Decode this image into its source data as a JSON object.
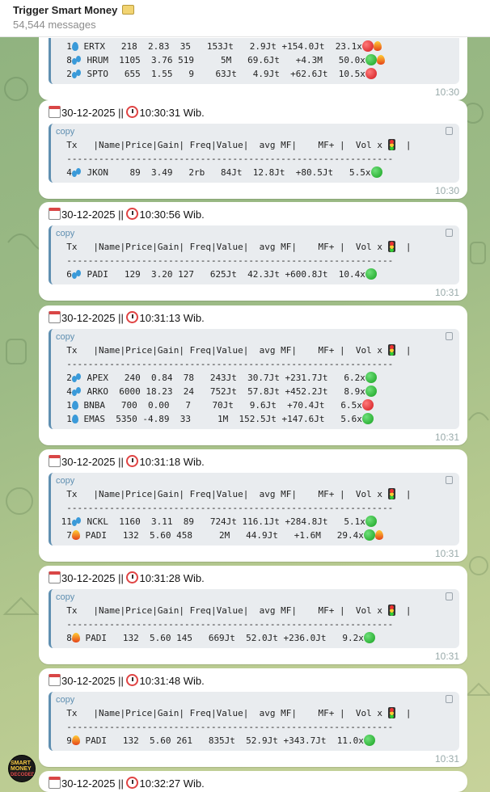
{
  "header": {
    "title": "Trigger Smart Money",
    "subtitle": "54,544 messages",
    "title_icon": "dollar-banknote-icon"
  },
  "code_lang": "copy",
  "table_header": "  Tx   |Name|Price|Gain| Freq|Value|  avg MF|    MF+ |  Vol x",
  "separator": "  -------------------------------------------------------------",
  "messages": [
    {
      "rows": [
        {
          "count": "1",
          "icon": "drop",
          "text": " ERTX   218  2.83  35   153Jt   2.9Jt +154.0Jt  23.1x",
          "status": "red",
          "extra": "fire"
        },
        {
          "count": "8",
          "icon": "drops",
          "text": " HRUM  1105  3.76 519     5M   69.6Jt   +4.3M   50.0x",
          "status": "green",
          "extra": "fire"
        },
        {
          "count": "2",
          "icon": "drops",
          "text": " SPTO   655  1.55   9    63Jt   4.9Jt  +62.6Jt  10.5x",
          "status": "red",
          "extra": ""
        }
      ],
      "time": "10:30"
    },
    {
      "date": "30-12-2025",
      "sep": " || ",
      "clock": "10:30:31 Wib.",
      "rows": [
        {
          "count": "4",
          "icon": "drops",
          "text": " JKON    89  3.49   2rb   84Jt  12.8Jt  +80.5Jt   5.5x",
          "status": "green",
          "extra": ""
        }
      ],
      "time": "10:30"
    },
    {
      "date": "30-12-2025",
      "sep": " || ",
      "clock": "10:30:56 Wib.",
      "rows": [
        {
          "count": "6",
          "icon": "drops",
          "text": " PADI   129  3.20 127   625Jt  42.3Jt +600.8Jt  10.4x",
          "status": "green",
          "extra": ""
        }
      ],
      "time": "10:31"
    },
    {
      "date": "30-12-2025",
      "sep": " || ",
      "clock": "10:31:13 Wib.",
      "rows": [
        {
          "count": "2",
          "icon": "drops",
          "text": " APEX   240  0.84  78   243Jt  30.7Jt +231.7Jt   6.2x",
          "status": "green",
          "extra": ""
        },
        {
          "count": "4",
          "icon": "drops",
          "text": " ARKO  6000 18.23  24   752Jt  57.8Jt +452.2Jt   8.9x",
          "status": "green",
          "extra": ""
        },
        {
          "count": "1",
          "icon": "drop",
          "text": " BNBA   700  0.00   7    70Jt   9.6Jt  +70.4Jt   6.5x",
          "status": "red",
          "extra": ""
        },
        {
          "count": "1",
          "icon": "drop",
          "text": " EMAS  5350 -4.89  33     1M  152.5Jt +147.6Jt   5.6x",
          "status": "green",
          "extra": ""
        }
      ],
      "time": "10:31"
    },
    {
      "date": "30-12-2025",
      "sep": " || ",
      "clock": "10:31:18 Wib.",
      "rows": [
        {
          "count": "11",
          "icon": "drops",
          "text": " NCKL  1160  3.11  89   724Jt 116.1Jt +284.8Jt   5.1x",
          "status": "green",
          "extra": ""
        },
        {
          "count": "7",
          "icon": "fire",
          "text": " PADI   132  5.60 458     2M   44.9Jt   +1.6M   29.4x",
          "status": "green",
          "extra": "fire"
        }
      ],
      "time": "10:31"
    },
    {
      "date": "30-12-2025",
      "sep": " || ",
      "clock": "10:31:28 Wib.",
      "rows": [
        {
          "count": "8",
          "icon": "fire",
          "text": " PADI   132  5.60 145   669Jt  52.0Jt +236.0Jt   9.2x",
          "status": "green",
          "extra": ""
        }
      ],
      "time": "10:31"
    },
    {
      "date": "30-12-2025",
      "sep": " || ",
      "clock": "10:31:48 Wib.",
      "rows": [
        {
          "count": "9",
          "icon": "fire",
          "text": " PADI   132  5.60 261   835Jt  52.9Jt +343.7Jt  11.0x",
          "status": "green",
          "extra": ""
        }
      ],
      "time": "10:31"
    },
    {
      "date": "30-12-2025",
      "sep": " || ",
      "clock": "10:32:27 Wib.",
      "rows": [],
      "time": ""
    }
  ],
  "avatar": {
    "line1": "SMART",
    "line2": "MONEY",
    "line3": "DECODED"
  }
}
